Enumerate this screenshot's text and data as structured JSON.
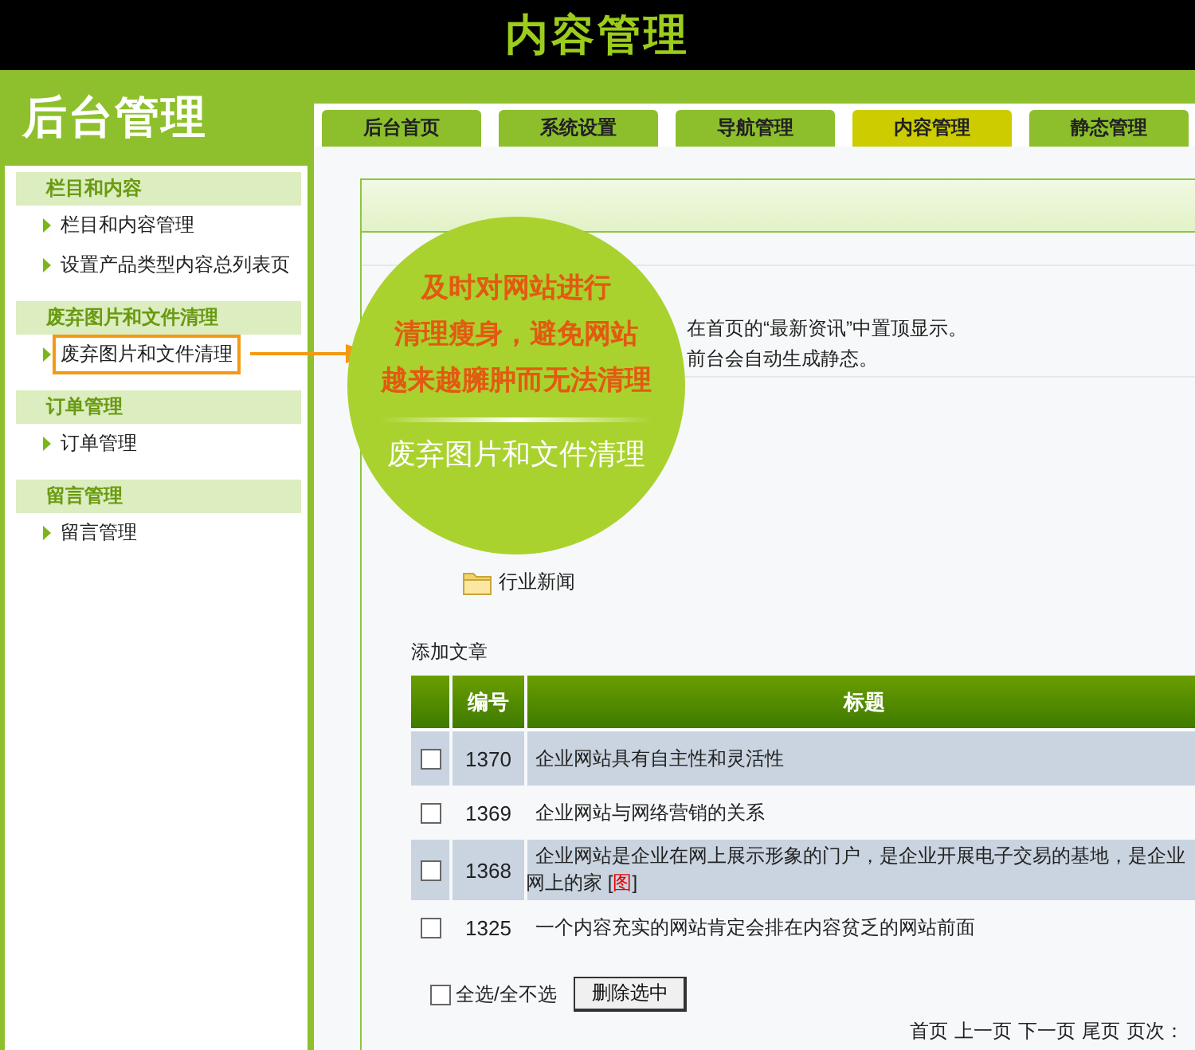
{
  "page_title": "内容管理",
  "sidebar": {
    "logo": "后台管理",
    "groups": [
      {
        "title": "栏目和内容",
        "items": [
          {
            "label": "栏目和内容管理",
            "selected": false
          },
          {
            "label": "设置产品类型内容总列表页",
            "selected": false
          }
        ]
      },
      {
        "title": "废弃图片和文件清理",
        "items": [
          {
            "label": "废弃图片和文件清理",
            "selected": true
          }
        ]
      },
      {
        "title": "订单管理",
        "items": [
          {
            "label": "订单管理",
            "selected": false
          }
        ]
      },
      {
        "title": "留言管理",
        "items": [
          {
            "label": "留言管理",
            "selected": false
          }
        ]
      }
    ]
  },
  "tabs": [
    {
      "label": "后台首页",
      "selected": false
    },
    {
      "label": "系统设置",
      "selected": false
    },
    {
      "label": "导航管理",
      "selected": false
    },
    {
      "label": "内容管理",
      "selected": true
    },
    {
      "label": "静态管理",
      "selected": false
    }
  ],
  "instructions": [
    "在首页的“最新资讯”中置顶显示。",
    "前台会自动生成静态。"
  ],
  "folders": [
    "行业新闻"
  ],
  "add_article": "添加文章",
  "table": {
    "columns": [
      "编号",
      "标题"
    ],
    "rows": [
      {
        "checked": false,
        "id": "1370",
        "title": "企业网站具有自主性和灵活性"
      },
      {
        "checked": false,
        "id": "1369",
        "title": "企业网站与网络营销的关系"
      },
      {
        "checked": false,
        "id": "1368",
        "title": "企业网站是企业在网上展示形象的门户，是企业开展电子交易的基地，是企业",
        "title_cont": "网上的家",
        "image_mark": {
          "open": "[",
          "text": "图",
          "close": "]"
        }
      },
      {
        "checked": false,
        "id": "1325",
        "title": "一个内容充实的网站肯定会排在内容贫乏的网站前面"
      }
    ]
  },
  "select_all": {
    "label": "全选/全不选",
    "checked": false
  },
  "delete_button": "删除选中",
  "pagination": [
    "首页",
    "上一页",
    "下一页",
    "尾页",
    "页次："
  ],
  "callout": {
    "lines": [
      "及时对网站进行",
      "清理瘦身，避免网站",
      "越来越臃肿而无法清理"
    ],
    "caption": "废弃图片和文件清理"
  }
}
